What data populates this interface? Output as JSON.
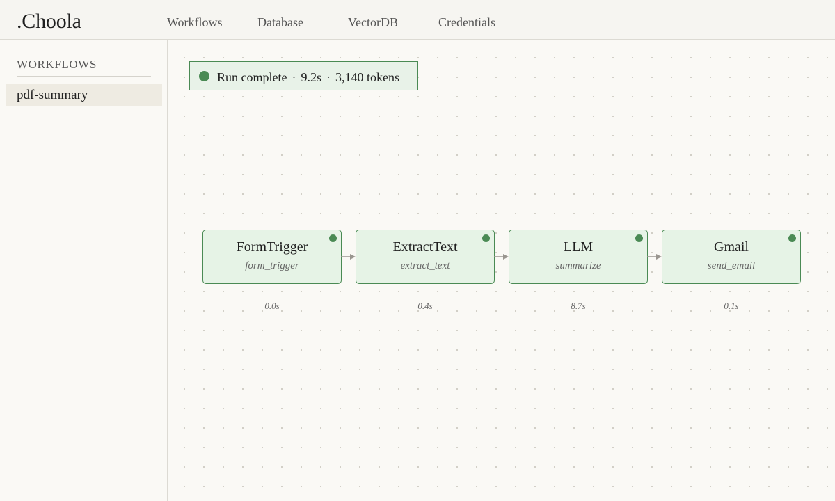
{
  "app": {
    "brand": ".Choola"
  },
  "nav": {
    "items": [
      {
        "label": "Workflows"
      },
      {
        "label": "Database"
      },
      {
        "label": "VectorDB"
      },
      {
        "label": "Credentials"
      }
    ]
  },
  "sidebar": {
    "heading": "WORKFLOWS",
    "items": [
      {
        "label": "pdf-summary"
      }
    ]
  },
  "status": {
    "label": "Run complete",
    "separator": "·",
    "duration": "9.2s",
    "tokens": "3,140 tokens",
    "color": "#4a8a54"
  },
  "nodes": [
    {
      "title": "FormTrigger",
      "subtitle": "form_trigger",
      "duration": "0.0s"
    },
    {
      "title": "ExtractText",
      "subtitle": "extract_text",
      "duration": "0.4s"
    },
    {
      "title": "LLM",
      "subtitle": "summarize",
      "duration": "8.7s"
    },
    {
      "title": "Gmail",
      "subtitle": "send_email",
      "duration": "0.1s"
    }
  ],
  "colors": {
    "success": "#4a8a54",
    "node_fill": "#e6f3e6",
    "edge": "#9a9690"
  }
}
